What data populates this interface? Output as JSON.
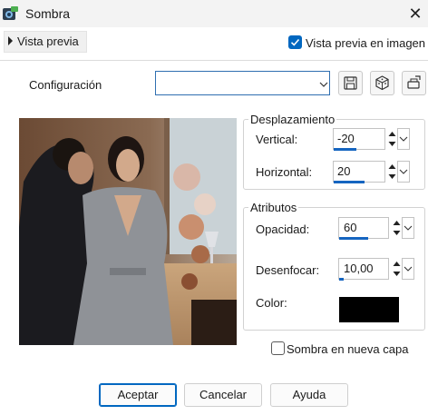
{
  "window": {
    "title": "Sombra",
    "close_icon": "close-icon"
  },
  "preview_bar": {
    "toggle_label": "Vista previa",
    "image_preview_label": "Vista previa en imagen",
    "image_preview_checked": true
  },
  "config": {
    "label": "Configuración",
    "value": "",
    "buttons": [
      "save-icon",
      "dice-icon",
      "reset-icon"
    ]
  },
  "offset": {
    "group_title": "Desplazamiento",
    "vertical_label": "Vertical:",
    "vertical_value": "-20",
    "vertical_fill": 0.45,
    "horizontal_label": "Horizontal:",
    "horizontal_value": "20",
    "horizontal_fill": 0.6
  },
  "attributes": {
    "group_title": "Atributos",
    "opacity_label": "Opacidad:",
    "opacity_value": "60",
    "opacity_fill": 0.6,
    "blur_label": "Desenfocar:",
    "blur_value": "10,00",
    "blur_fill": 0.1,
    "color_label": "Color:",
    "color_value": "#000000"
  },
  "shadow_new_layer": {
    "label": "Sombra en nueva capa",
    "checked": false
  },
  "buttons": {
    "ok": "Aceptar",
    "cancel": "Cancelar",
    "help": "Ayuda"
  },
  "colors": {
    "accent": "#0067c0",
    "bar": "#1565c0"
  }
}
